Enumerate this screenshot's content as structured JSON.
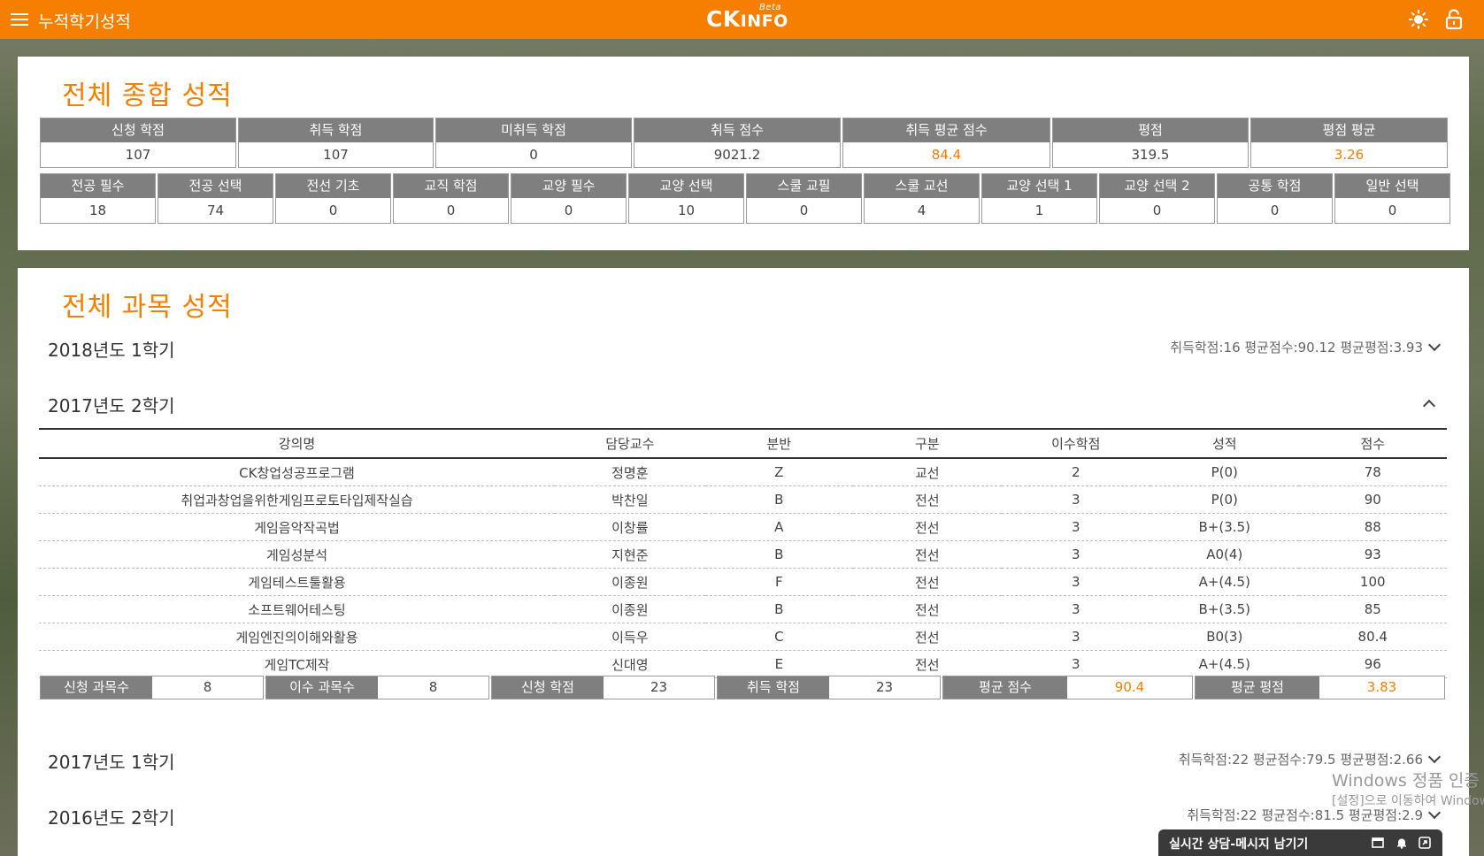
{
  "header": {
    "title": "누적학기성적",
    "logo_main": "CK",
    "logo_sub": "INFO",
    "logo_badge": "Beta",
    "accent": "#f67e00"
  },
  "overall": {
    "title": "전체 종합 성적",
    "row1": [
      {
        "label": "신청 학점",
        "value": "107"
      },
      {
        "label": "취득 학점",
        "value": "107"
      },
      {
        "label": "미취득 학점",
        "value": "0"
      },
      {
        "label": "취득 점수",
        "value": "9021.2"
      },
      {
        "label": "취득 평균 점수",
        "value": "84.4"
      },
      {
        "label": "평점",
        "value": "319.5"
      },
      {
        "label": "평점 평균",
        "value": "3.26"
      }
    ],
    "row2": [
      {
        "label": "전공 필수",
        "value": "18"
      },
      {
        "label": "전공 선택",
        "value": "74"
      },
      {
        "label": "전선 기초",
        "value": "0"
      },
      {
        "label": "교직 학점",
        "value": "0"
      },
      {
        "label": "교양 필수",
        "value": "0"
      },
      {
        "label": "교양 선택",
        "value": "10"
      },
      {
        "label": "스쿨 교필",
        "value": "0"
      },
      {
        "label": "스쿨 교선",
        "value": "4"
      },
      {
        "label": "교양 선택 1",
        "value": "1"
      },
      {
        "label": "교양 선택 2",
        "value": "0"
      },
      {
        "label": "공통 학점",
        "value": "0"
      },
      {
        "label": "일반 선택",
        "value": "0"
      }
    ]
  },
  "courses": {
    "title": "전체 과목 성적",
    "semesters": [
      {
        "name": "2018년도 1학기",
        "summary": "취득학점:16 평균점수:90.12 평균평점:3.93"
      },
      {
        "name": "2017년도 2학기",
        "summary": ""
      },
      {
        "name": "2017년도 1학기",
        "summary": "취득학점:22 평균점수:79.5 평균평점:2.66"
      },
      {
        "name": "2016년도 2학기",
        "summary": "취득학점:22 평균점수:81.5 평균평점:2.9"
      }
    ],
    "table": {
      "headers": [
        "강의명",
        "담당교수",
        "분반",
        "구분",
        "이수학점",
        "성적",
        "점수"
      ],
      "rows": [
        [
          "CK창업성공프로그램",
          "정명훈",
          "Z",
          "교선",
          "2",
          "P(0)",
          "78"
        ],
        [
          "취업과창업을위한게임프로토타입제작실습",
          "박찬일",
          "B",
          "전선",
          "3",
          "P(0)",
          "90"
        ],
        [
          "게임음악작곡법",
          "이창률",
          "A",
          "전선",
          "3",
          "B+(3.5)",
          "88"
        ],
        [
          "게임성분석",
          "지현준",
          "B",
          "전선",
          "3",
          "A0(4)",
          "93"
        ],
        [
          "게임테스트툴활용",
          "이종원",
          "F",
          "전선",
          "3",
          "A+(4.5)",
          "100"
        ],
        [
          "소프트웨어테스팅",
          "이종원",
          "B",
          "전선",
          "3",
          "B+(3.5)",
          "85"
        ],
        [
          "게임엔진의이해와활용",
          "이득우",
          "C",
          "전선",
          "3",
          "B0(3)",
          "80.4"
        ],
        [
          "게임TC제작",
          "신대영",
          "E",
          "전선",
          "3",
          "A+(4.5)",
          "96"
        ]
      ]
    },
    "totals": [
      {
        "label": "신청 과목수",
        "value": "8"
      },
      {
        "label": "이수 과목수",
        "value": "8"
      },
      {
        "label": "신청 학점",
        "value": "23"
      },
      {
        "label": "취득 학점",
        "value": "23"
      },
      {
        "label": "평균 점수",
        "value": "90.4"
      },
      {
        "label": "평균 평점",
        "value": "3.83"
      }
    ]
  },
  "watermark": {
    "line1": "Windows 정품 인증",
    "line2": "[설정]으로 이동하여 Windows"
  },
  "chat": {
    "label": "실시간 상담-메시지 남기기"
  }
}
